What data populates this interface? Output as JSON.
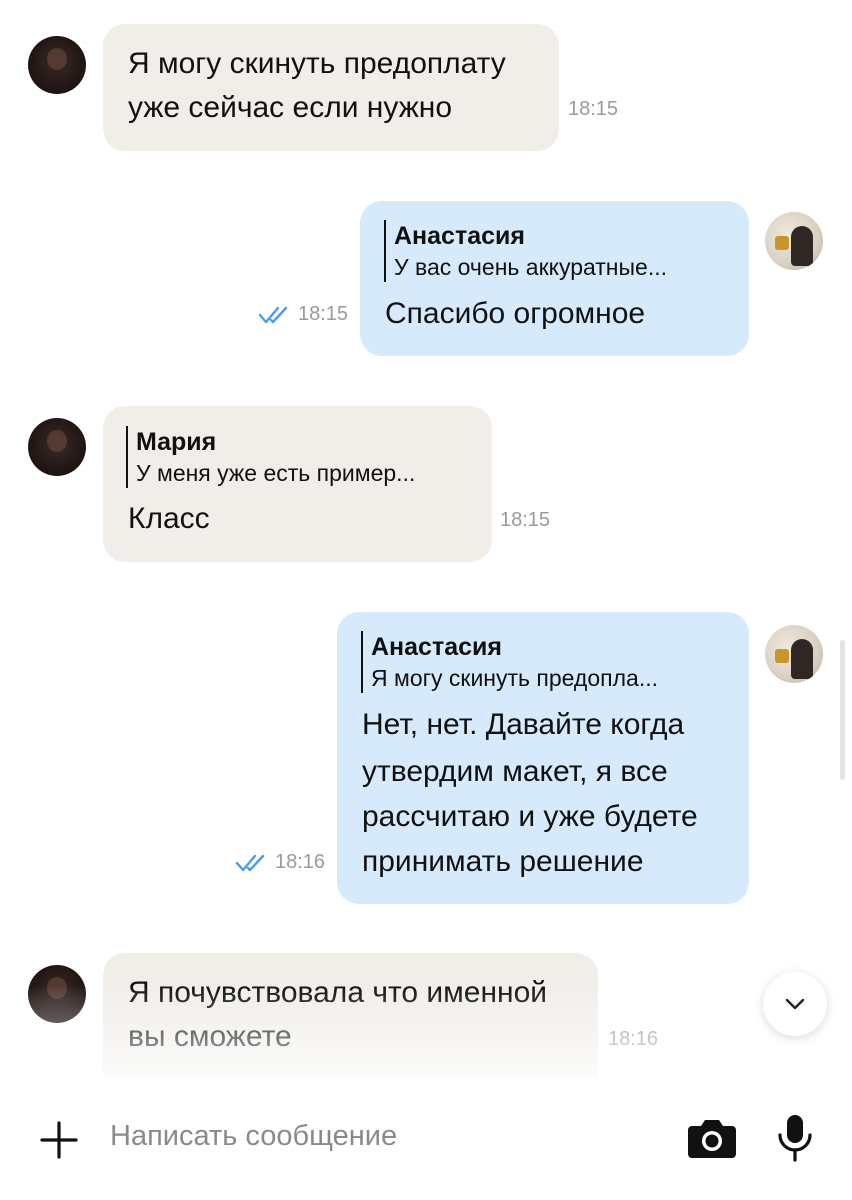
{
  "messages": [
    {
      "direction": "incoming",
      "text_lines": [
        "Я могу скинуть предоплату",
        "уже сейчас если нужно"
      ],
      "time": "18:15"
    },
    {
      "direction": "outgoing",
      "reply_to": {
        "name": "Анастасия",
        "preview": "У вас очень аккуратные..."
      },
      "text_lines": [
        "Спасибо огромное"
      ],
      "time": "18:15",
      "read": true
    },
    {
      "direction": "incoming",
      "reply_to": {
        "name": "Мария",
        "preview": "У меня уже есть пример..."
      },
      "text_lines": [
        "Класс"
      ],
      "time": "18:15"
    },
    {
      "direction": "outgoing",
      "reply_to": {
        "name": "Анастасия",
        "preview": "Я могу скинуть предопла..."
      },
      "text_lines": [
        "Нет, нет. Давайте когда",
        "утвердим макет, я все",
        "рассчитаю и уже будете",
        "принимать решение"
      ],
      "time": "18:16",
      "read": true
    },
    {
      "direction": "incoming",
      "text_lines": [
        "Я почувствовала что именной",
        "вы сможете"
      ],
      "time": "18:16"
    }
  ],
  "composer": {
    "placeholder": "Написать сообщение",
    "icons": [
      "plus-icon",
      "camera-icon",
      "microphone-icon"
    ]
  },
  "scroll_down_icon": "chevron-down-icon",
  "colors": {
    "incoming_bubble": "#f1eeea",
    "outgoing_bubble": "#d6eafb",
    "read_check": "#4a9be8",
    "time_text": "#9a9a9a"
  }
}
